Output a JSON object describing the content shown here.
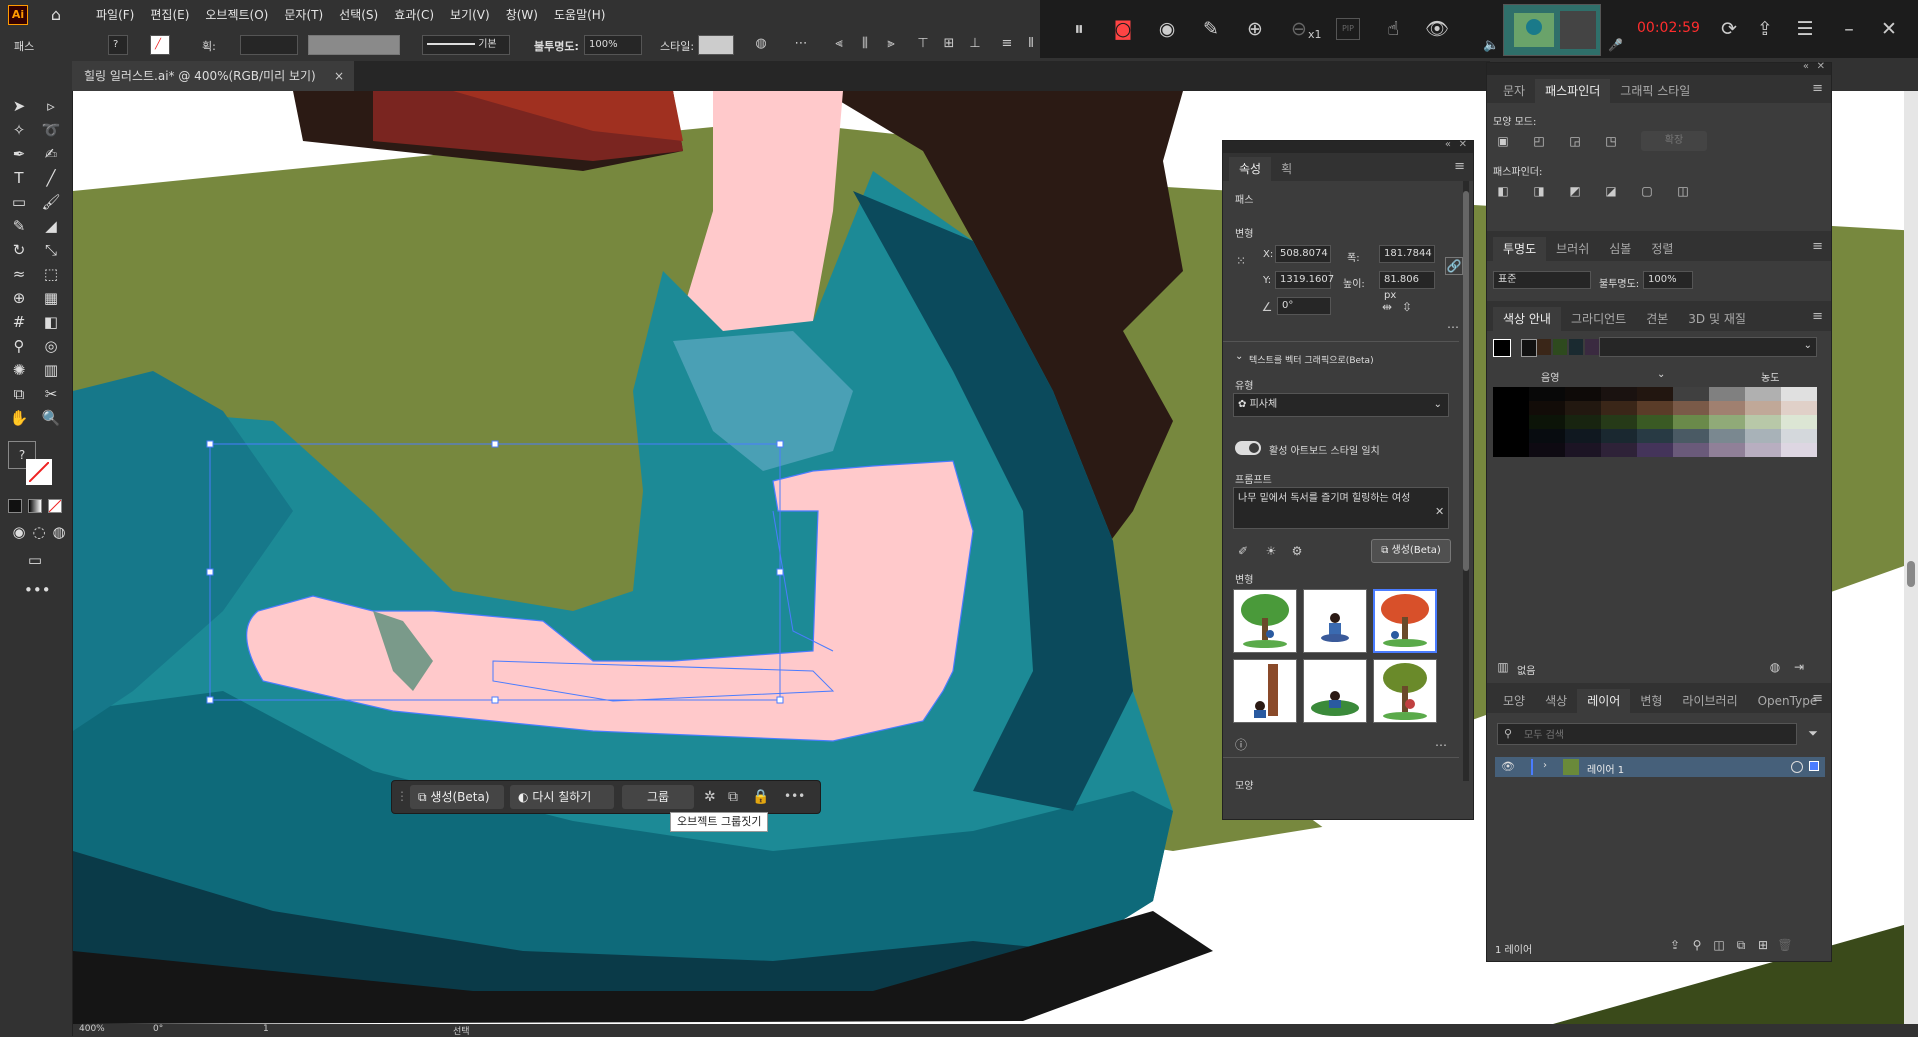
{
  "app": {
    "logo": "Ai",
    "home_icon": "home-icon"
  },
  "menu": [
    "파일(F)",
    "편집(E)",
    "오브젝트(O)",
    "문자(T)",
    "선택(S)",
    "효과(C)",
    "보기(V)",
    "창(W)",
    "도움말(H)"
  ],
  "recorder": {
    "time": "00:02:59",
    "zoom_label": "x1",
    "pip_label": "PIP"
  },
  "controlbar": {
    "selection_label": "패스",
    "stroke_label": "획:",
    "brush_label": "기본",
    "opacity_label": "불투명도:",
    "opacity_value": "100%",
    "style_label": "스타일:"
  },
  "document": {
    "tab_title": "힐링 일러스트.ai* @ 400%(RGB/미리 보기)",
    "close": "×"
  },
  "properties": {
    "tabs": [
      "속성",
      "획"
    ],
    "section_path": "패스",
    "section_transform": "변형",
    "x_label": "X:",
    "x_value": "508.8074",
    "y_label": "Y:",
    "y_value": "1319.1607",
    "w_label": "폭:",
    "w_value": "181.7844",
    "h_label": "높이:",
    "h_value": "81.806 px",
    "angle_value": "0°",
    "text_to_vector": "텍스트를 벡터 그래픽으로(Beta)",
    "type_label": "유형",
    "type_value": "피사체",
    "toggle_label": "활성 아트보드 스타일 일치",
    "prompt_label": "프롬프트",
    "prompt_value": "나무 밑에서 독서를 즐기며 힐링하는 여성",
    "generate": "생성(Beta)",
    "variations_label": "변형",
    "appearance_label": "모양"
  },
  "pathfinder": {
    "tabs": [
      "문자",
      "패스파인더",
      "그래픽 스타일"
    ],
    "shape_modes": "모양 모드:",
    "expand": "확장",
    "pathfinders": "패스파인더:"
  },
  "transparency": {
    "tabs": [
      "투명도",
      "브러쉬",
      "심볼",
      "정렬"
    ],
    "blend": "표준",
    "opacity_label": "불투명도:",
    "opacity_value": "100%"
  },
  "color_guide": {
    "tabs": [
      "색상 안내",
      "그라디언트",
      "견본",
      "3D 및 재질"
    ],
    "shade_label": "음영",
    "tint_label": "농도",
    "none_label": "없음"
  },
  "layers": {
    "tabs": [
      "모양",
      "색상",
      "레이어",
      "변형",
      "라이브러리",
      "OpenType"
    ],
    "search_placeholder": "모두 검색",
    "layer_name": "레이어 1",
    "count": "1 레이어"
  },
  "context": {
    "generate": "생성(Beta)",
    "recolor": "다시 칠하기",
    "group": "그룹",
    "more": "•••",
    "tooltip": "오브젝트 그룹짓기"
  },
  "status": {
    "zoom": "400%",
    "angle": "0°",
    "page": "1",
    "tool": "선택"
  },
  "colors": {
    "teal": "#1c8a96",
    "pink": "#ffc9cb",
    "green": "#77883e",
    "darkteal": "#0b4a5c",
    "hair": "#2b1a14",
    "selection": "#4a7cff"
  }
}
